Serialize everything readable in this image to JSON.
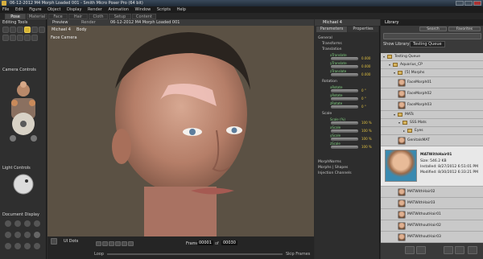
{
  "window": {
    "title": "06-12-2012 M4 Morph Loaded 001 - Smith Micro Poser Pro (64 bit)"
  },
  "menu": [
    "File",
    "Edit",
    "Figure",
    "Object",
    "Display",
    "Render",
    "Animation",
    "Window",
    "Scripts",
    "Help"
  ],
  "rooms": {
    "tabs": [
      "Pose",
      "Material",
      "Face",
      "Hair",
      "Cloth",
      "Setup",
      "Content"
    ],
    "active": "Pose"
  },
  "left_panel": {
    "editing_tools_label": "Editing Tools",
    "camera_controls_label": "Camera Controls",
    "light_controls_label": "Light Controls",
    "document_display_label": "Document Display"
  },
  "viewport": {
    "tabs": [
      "Preview",
      "Render"
    ],
    "document_title": "06-12-2012 M4 Morph Loaded 001",
    "figure_selector": "Michael 4",
    "actor_selector": "Body",
    "camera_label": "Face Camera"
  },
  "timeline": {
    "ui_dots_label": "UI Dots",
    "frame_label": "Frame",
    "frame_current": "00001",
    "frame_total": "00030",
    "loop_label": "Loop",
    "skip_frames_label": "Skip Frames"
  },
  "parameters": {
    "panel_title": "Michael 4",
    "tabs": [
      "Parameters",
      "Properties"
    ],
    "group_general": "General",
    "group_transforms": "Transforms",
    "group_translation": "Translation",
    "translation": [
      {
        "label": "xTranslate",
        "value": "0.000"
      },
      {
        "label": "yTranslate",
        "value": "0.000"
      },
      {
        "label": "zTranslate",
        "value": "0.000"
      }
    ],
    "group_rotation": "Rotation",
    "rotation": [
      {
        "label": "xRotate",
        "value": "0 °"
      },
      {
        "label": "yRotate",
        "value": "0 °"
      },
      {
        "label": "zRotate",
        "value": "0 °"
      }
    ],
    "group_scale": "Scale",
    "scale": [
      {
        "label": "Scale (%)",
        "value": "100 %"
      },
      {
        "label": "xScale",
        "value": "100 %"
      },
      {
        "label": "yScale",
        "value": "100 %"
      },
      {
        "label": "zScale",
        "value": "100 %"
      }
    ],
    "group_morph_norms": "MorphNorms",
    "group_morphs_shapes": "Morphs | Shapes",
    "group_injection_channels": "Injection Channels"
  },
  "library": {
    "title": "Library",
    "tabs": [
      "Search",
      "Favorites"
    ],
    "show_library_label": "Show Library:",
    "show_library_value": "Testing Queue",
    "tree": [
      {
        "indent": 0,
        "kind": "folder",
        "text": "Testing Queue"
      },
      {
        "indent": 1,
        "kind": "folder",
        "text": "Aquarius_CP"
      },
      {
        "indent": 2,
        "kind": "folder",
        "text": "[5] Morphs"
      },
      {
        "indent": 3,
        "kind": "item",
        "text": "FaceMorph01"
      },
      {
        "indent": 3,
        "kind": "item",
        "text": "FaceMorph02"
      },
      {
        "indent": 3,
        "kind": "item",
        "text": "FaceMorph03"
      },
      {
        "indent": 2,
        "kind": "folder",
        "text": "MATs"
      },
      {
        "indent": 3,
        "kind": "folder",
        "text": "SSS Mats"
      },
      {
        "indent": 4,
        "kind": "folder",
        "text": "Eyes"
      },
      {
        "indent": 3,
        "kind": "item",
        "text": "GenitalsMAT"
      }
    ],
    "selected": {
      "name": "MATWithHair01",
      "size": "Size: 546.2 KB",
      "installed": "Installed: 8/27/2012 6:51:01 PM",
      "modified": "Modified: 8/30/2012 6:33:21 PM"
    },
    "items_after": [
      "MATWithHair02",
      "MATWithHair03",
      "MATWithoutHair01",
      "MATWithoutHair02",
      "MATWithoutHair03"
    ]
  },
  "colors": {
    "accent": "#d4b334",
    "viewport_bg": "#5b5144",
    "dial_label": "#7fd07f",
    "dial_value": "#e0c040"
  }
}
